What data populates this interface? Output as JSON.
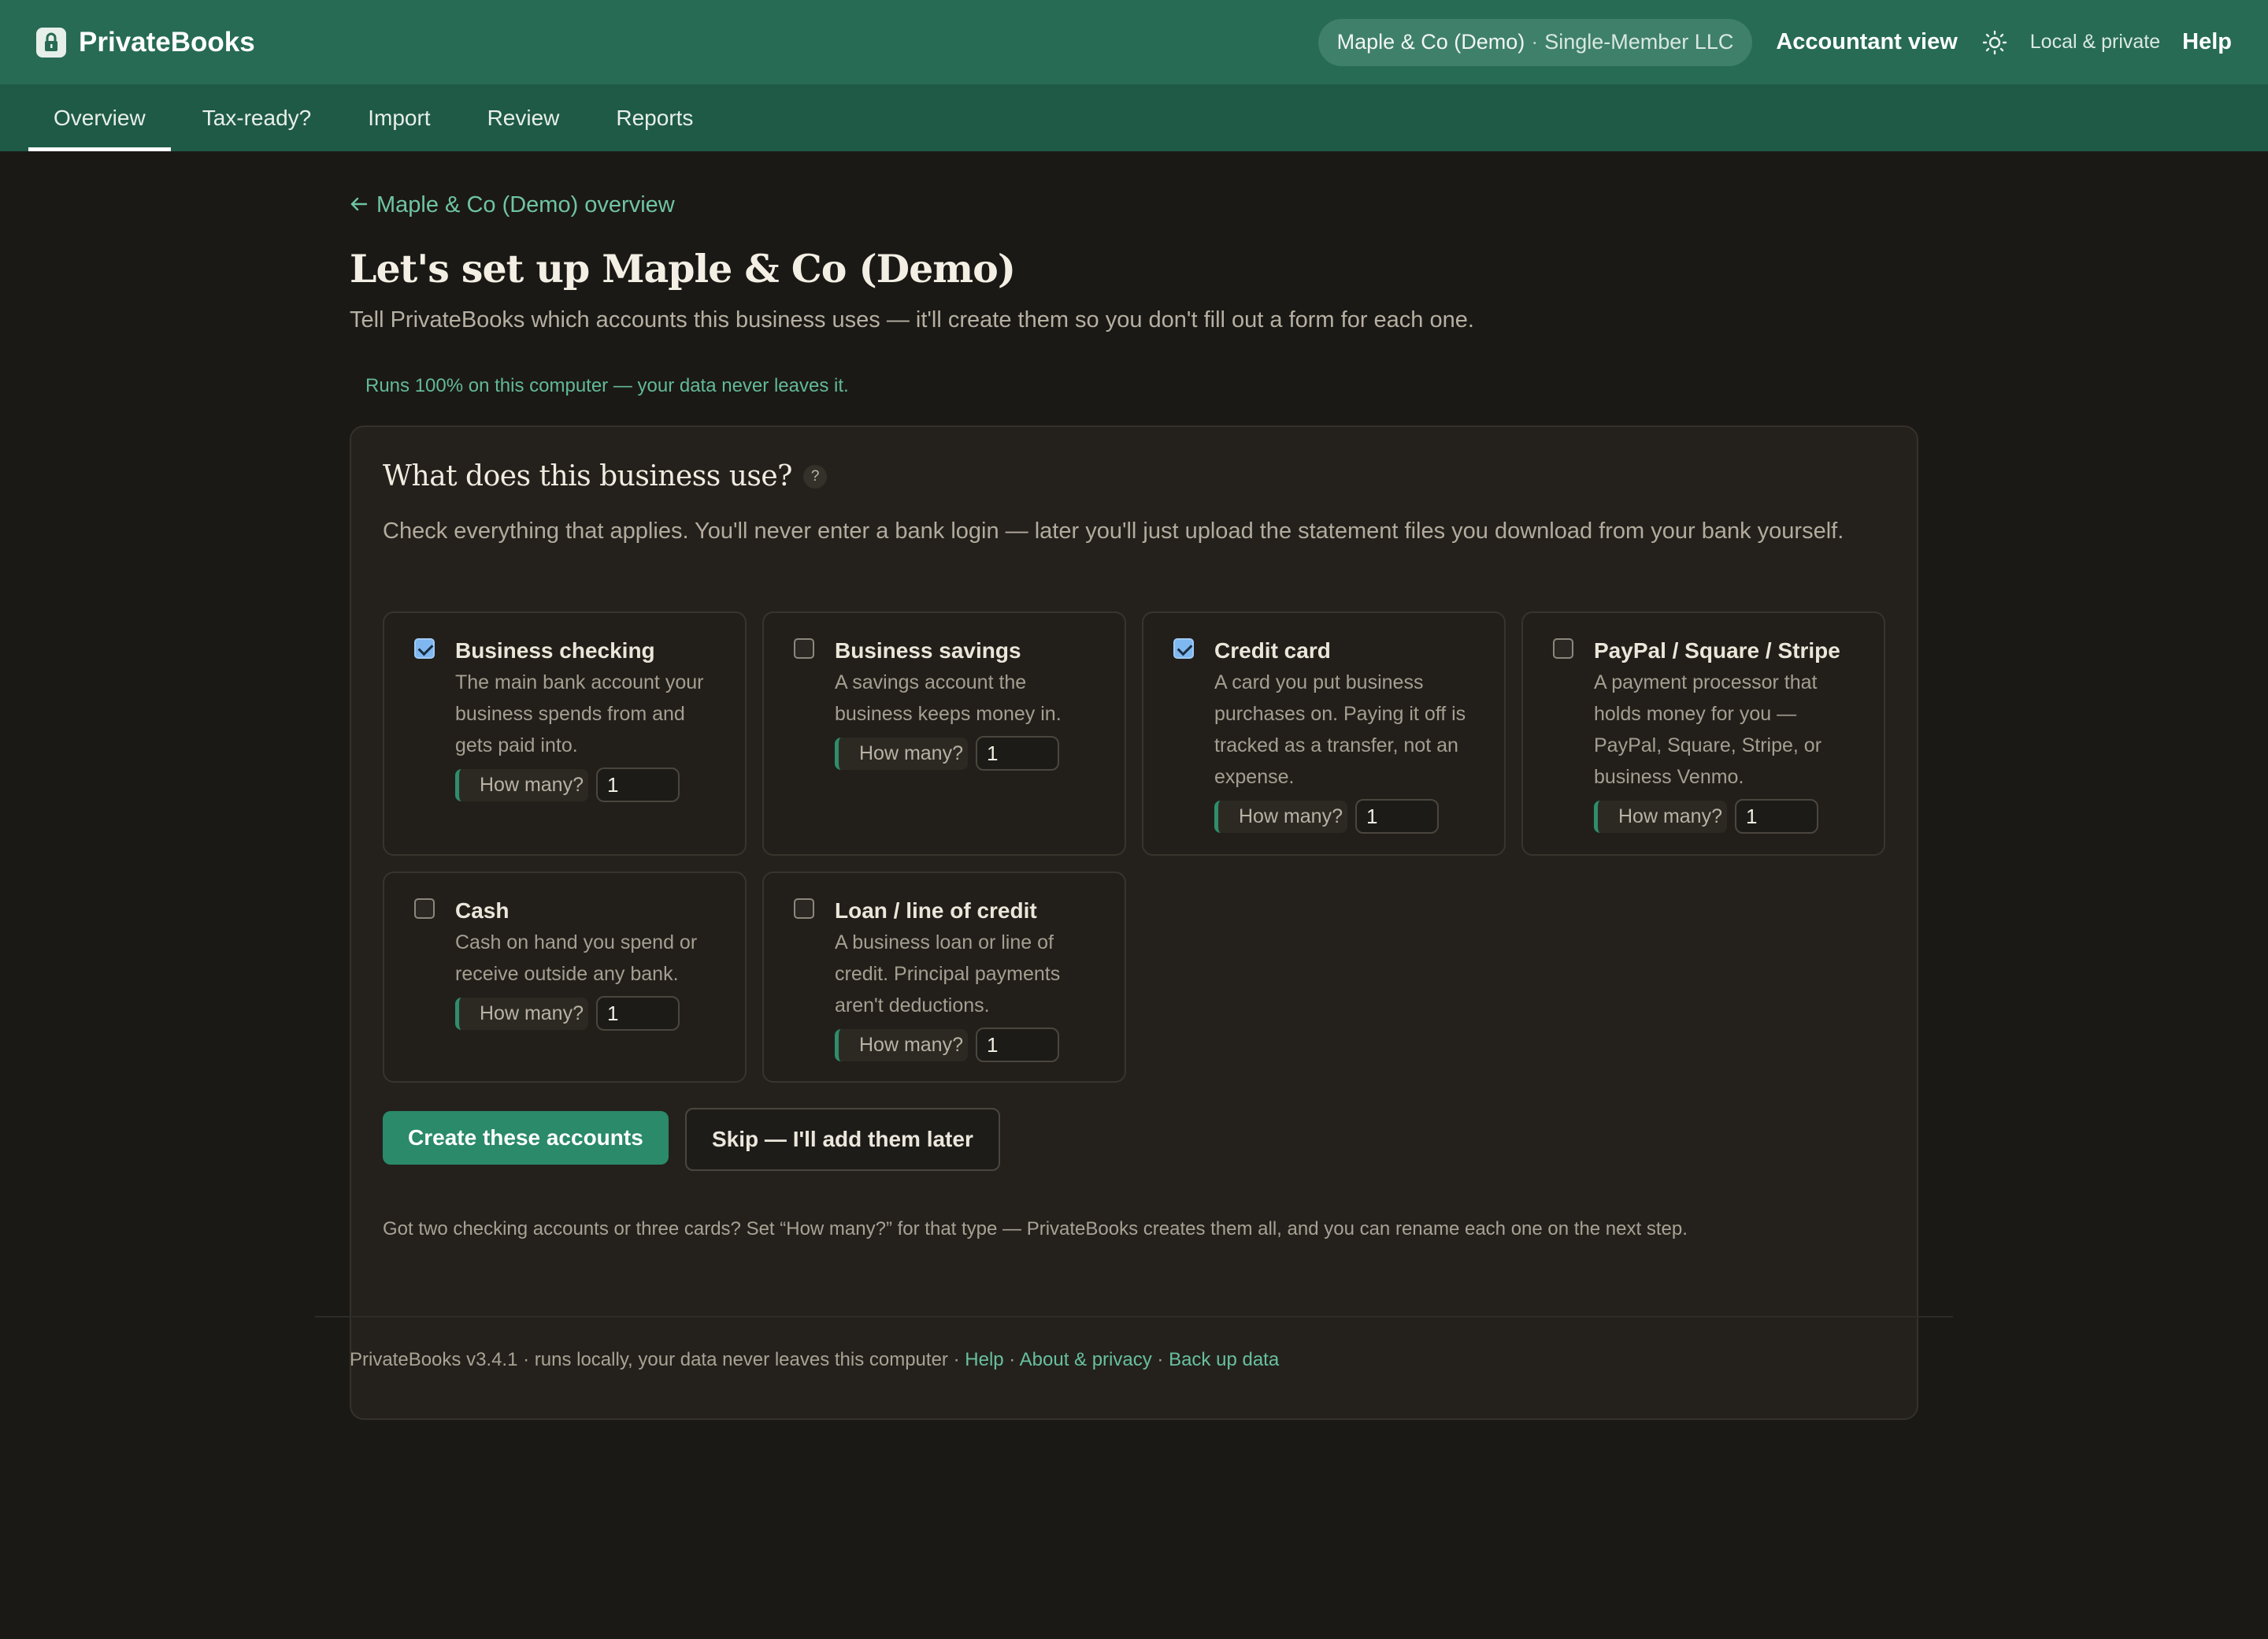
{
  "app": {
    "name": "PrivateBooks",
    "business_name": "Maple & Co (Demo)",
    "business_type": "Single-Member LLC",
    "accountant_view": "Accountant view",
    "privacy_label": "Local & private",
    "help": "Help"
  },
  "tabs": [
    {
      "label": "Overview",
      "active": true
    },
    {
      "label": "Tax-ready?",
      "active": false
    },
    {
      "label": "Import",
      "active": false
    },
    {
      "label": "Review",
      "active": false
    },
    {
      "label": "Reports",
      "active": false
    }
  ],
  "page": {
    "back_link": "Maple & Co (Demo) overview",
    "title": "Let's set up Maple & Co (Demo)",
    "subtitle": "Tell PrivateBooks which accounts this business uses — it'll create them so you don't fill out a form for each one.",
    "local_note": "Runs 100% on this computer — your data never leaves it."
  },
  "setup": {
    "title": "What does this business use?",
    "help_badge": "?",
    "description": "Check everything that applies. You'll never enter a bank login — later you'll just upload the statement files you download from your bank yourself.",
    "how_many_label": "How many?",
    "options": [
      {
        "label": "Business checking",
        "hint": "The main bank account your business spends from and gets paid into.",
        "checked": true,
        "count": "1"
      },
      {
        "label": "Business savings",
        "hint": "A savings account the business keeps money in.",
        "checked": false,
        "count": "1"
      },
      {
        "label": "Credit card",
        "hint": "A card you put business purchases on. Paying it off is tracked as a transfer, not an expense.",
        "checked": true,
        "count": "1"
      },
      {
        "label": "PayPal / Square / Stripe",
        "hint": "A payment processor that holds money for you — PayPal, Square, Stripe, or business Venmo.",
        "checked": false,
        "count": "1"
      },
      {
        "label": "Cash",
        "hint": "Cash on hand you spend or receive outside any bank.",
        "checked": false,
        "count": "1"
      },
      {
        "label": "Loan / line of credit",
        "hint": "A business loan or line of credit. Principal payments aren't deductions.",
        "checked": false,
        "count": "1"
      }
    ],
    "create_button": "Create these accounts",
    "skip_button": "Skip — I'll add them later",
    "footnote": "Got two checking accounts or three cards? Set “How many?” for that type — PrivateBooks creates them all, and you can rename each one on the next step."
  },
  "footer": {
    "version_text": "PrivateBooks v3.4.1 · runs locally, your data never leaves this computer",
    "dot": "·",
    "links": [
      "Help",
      "About & privacy",
      "Back up data"
    ]
  }
}
